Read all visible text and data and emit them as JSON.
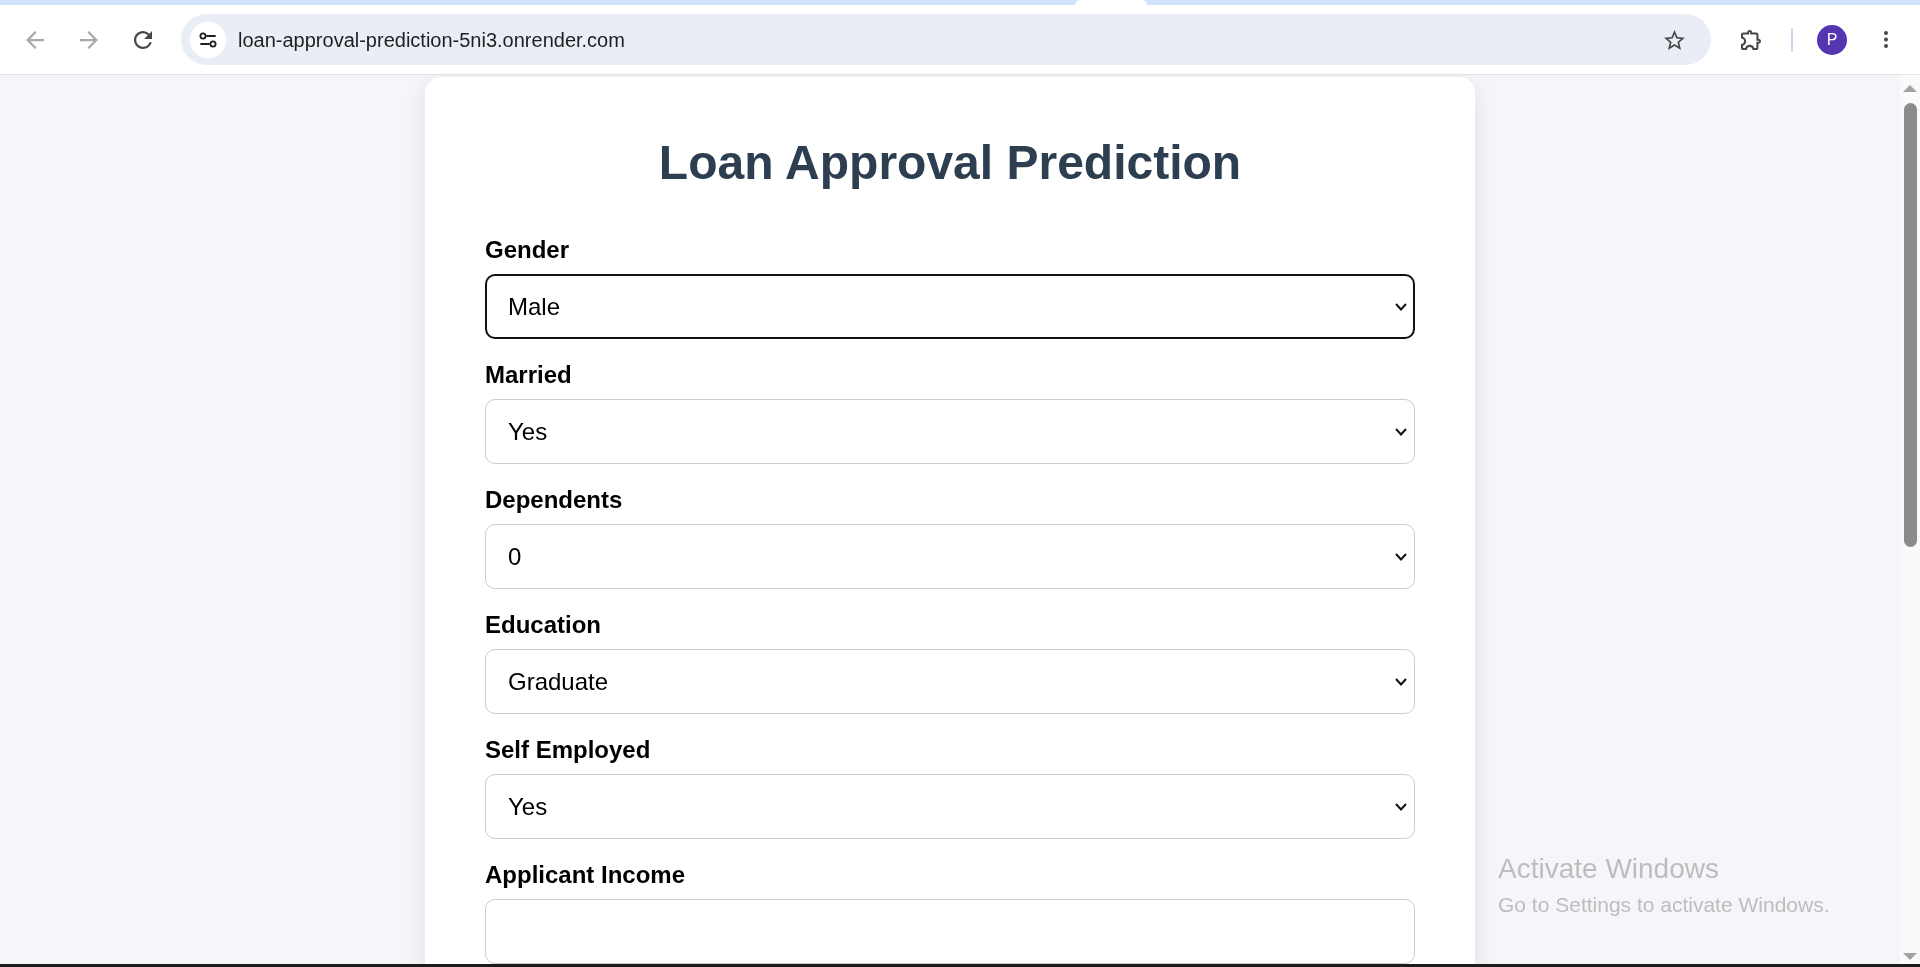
{
  "browser": {
    "toolbar_buttons": [
      {
        "kind": "back",
        "disabled": true
      },
      {
        "kind": "forward",
        "disabled": true
      },
      {
        "kind": "reload",
        "disabled": false
      }
    ],
    "address_bar": {
      "url": "loan-approval-prediction-5ni3.onrender.com"
    },
    "profile": {
      "initial": "P"
    }
  },
  "page": {
    "title": "Loan Approval Prediction",
    "fields": [
      {
        "label": "Gender",
        "kind": "select",
        "value": "Male",
        "focused": true
      },
      {
        "label": "Married",
        "kind": "select",
        "value": "Yes",
        "focused": false
      },
      {
        "label": "Dependents",
        "kind": "select",
        "value": "0",
        "focused": false
      },
      {
        "label": "Education",
        "kind": "select",
        "value": "Graduate",
        "focused": false
      },
      {
        "label": "Self Employed",
        "kind": "select",
        "value": "Yes",
        "focused": false
      },
      {
        "label": "Applicant Income",
        "kind": "text",
        "focused": false
      }
    ]
  },
  "os_notice": {
    "title": "Activate Windows",
    "message": "Go to Settings to activate Windows."
  }
}
